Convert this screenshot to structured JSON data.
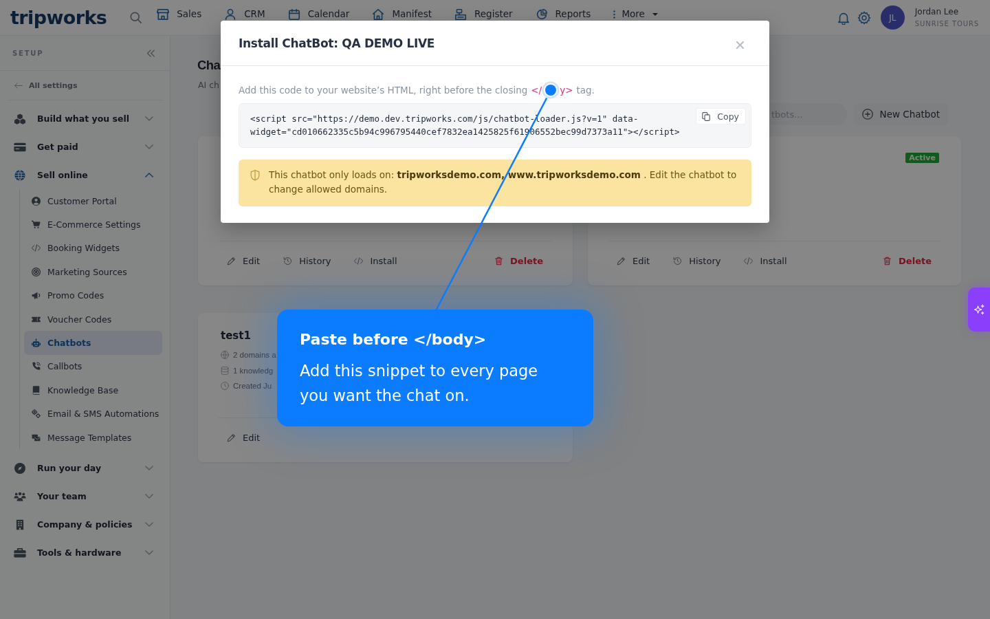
{
  "top_nav": {
    "logo": "tripworks",
    "items": [
      {
        "label": "Sales"
      },
      {
        "label": "CRM"
      },
      {
        "label": "Calendar"
      },
      {
        "label": "Manifest"
      },
      {
        "label": "Register"
      },
      {
        "label": "Reports"
      }
    ],
    "more": {
      "label": "More"
    },
    "user": {
      "initials": "JL",
      "name": "Jordan Lee",
      "company": "SUNRISE TOURS"
    }
  },
  "sidebar": {
    "heading": "SETUP",
    "back_link": "All settings",
    "sections": [
      {
        "label": "Build what you sell",
        "expanded": false
      },
      {
        "label": "Get paid",
        "expanded": false
      },
      {
        "label": "Sell online",
        "expanded": true,
        "children": [
          {
            "label": "Customer Portal",
            "selected": false
          },
          {
            "label": "E-Commerce Settings",
            "selected": false
          },
          {
            "label": "Booking Widgets",
            "selected": false
          },
          {
            "label": "Marketing Sources",
            "selected": false
          },
          {
            "label": "Promo Codes",
            "selected": false
          },
          {
            "label": "Voucher Codes",
            "selected": false
          },
          {
            "label": "Chatbots",
            "selected": true
          },
          {
            "label": "Callbots",
            "selected": false
          },
          {
            "label": "Knowledge Base",
            "selected": false
          },
          {
            "label": "Email & SMS Automations",
            "selected": false
          },
          {
            "label": "Message Templates",
            "selected": false
          }
        ]
      },
      {
        "label": "Run your day",
        "expanded": false
      },
      {
        "label": "Your team",
        "expanded": false
      },
      {
        "label": "Company & policies",
        "expanded": false
      },
      {
        "label": "Tools & hardware",
        "expanded": false
      }
    ]
  },
  "page": {
    "title": "Cha",
    "subtitle": "AI ch",
    "search": {
      "placeholder": "tbots..."
    },
    "new_button": "New Chatbot",
    "cards": [
      {
        "actions": [
          {
            "label": "Edit",
            "kind": "edit"
          },
          {
            "label": "History",
            "kind": "history"
          },
          {
            "label": "Install",
            "kind": "install"
          },
          {
            "label": "Delete",
            "kind": "delete"
          }
        ]
      },
      {
        "badge": "Active",
        "actions": [
          {
            "label": "Edit",
            "kind": "edit"
          },
          {
            "label": "History",
            "kind": "history"
          },
          {
            "label": "Install",
            "kind": "install"
          },
          {
            "label": "Delete",
            "kind": "delete"
          }
        ]
      },
      {
        "title": "test1",
        "meta": [
          {
            "text": "2 domains a",
            "kind": "domains"
          },
          {
            "text": "1 knowledg",
            "kind": "knowledge"
          },
          {
            "text": "Created Ju",
            "kind": "created"
          }
        ],
        "actions": [
          {
            "label": "Edit",
            "kind": "edit"
          }
        ]
      }
    ]
  },
  "modal": {
    "title": "Install ChatBot: QA DEMO LIVE",
    "instruction": {
      "text": "Add this code to your website’s HTML, right before the closing",
      "tag_start": "</",
      "tag_end": "y>",
      "text_after": "tag."
    },
    "code_lines": [
      "<script src=\"https://demo.dev.tripworks.com/js/chatbot-loader.js?v=1\" data-",
      "widget=\"cd010662335c5b94c996795440cef7832ea1425825f61906552bec99d7373a11\"></script>"
    ],
    "copy_button": "Copy",
    "notice": "This chatbot only loads on: **tripworksdemo.com, www.tripworksdemo.com** . Edit the chatbot to change allowed domains."
  },
  "tooltip": {
    "title": "Paste before </body>",
    "text": "Add this snippet to every page you want the chat on."
  }
}
